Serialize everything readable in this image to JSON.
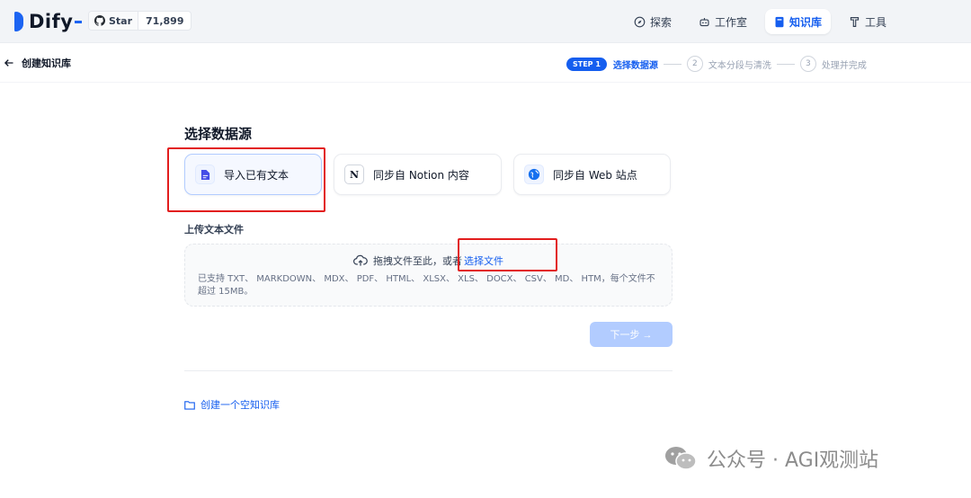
{
  "app": {
    "name": "Dify"
  },
  "github": {
    "star_label": "Star",
    "star_count": "71,899"
  },
  "nav": {
    "items": [
      {
        "label": "探索",
        "icon": "compass-icon"
      },
      {
        "label": "工作室",
        "icon": "robot-icon"
      },
      {
        "label": "知识库",
        "icon": "book-icon",
        "active": true
      },
      {
        "label": "工具",
        "icon": "tool-icon"
      }
    ]
  },
  "page": {
    "back_label": "创建知识库"
  },
  "steps": {
    "active_badge": "STEP 1",
    "items": [
      {
        "num": "1",
        "label": "选择数据源"
      },
      {
        "num": "2",
        "label": "文本分段与清洗"
      },
      {
        "num": "3",
        "label": "处理并完成"
      }
    ]
  },
  "datasource": {
    "title": "选择数据源",
    "options": [
      {
        "label": "导入已有文本",
        "icon": "file-icon",
        "selected": true
      },
      {
        "label": "同步自 Notion 内容",
        "icon": "notion-icon"
      },
      {
        "label": "同步自 Web 站点",
        "icon": "globe-icon"
      }
    ]
  },
  "upload": {
    "label": "上传文本文件",
    "drag_text": "拖拽文件至此，或者",
    "select_link": "选择文件",
    "hint": "已支持 TXT、 MARKDOWN、 MDX、 PDF、 HTML、 XLSX、 XLS、 DOCX、 CSV、 MD、 HTM，每个文件不超过 15MB。"
  },
  "next_button": "下一步 →",
  "empty_kb_link": "创建一个空知识库",
  "watermark": "公众号 · AGI观测站",
  "colors": {
    "accent": "#155eef",
    "highlight": "#e21d1d"
  }
}
